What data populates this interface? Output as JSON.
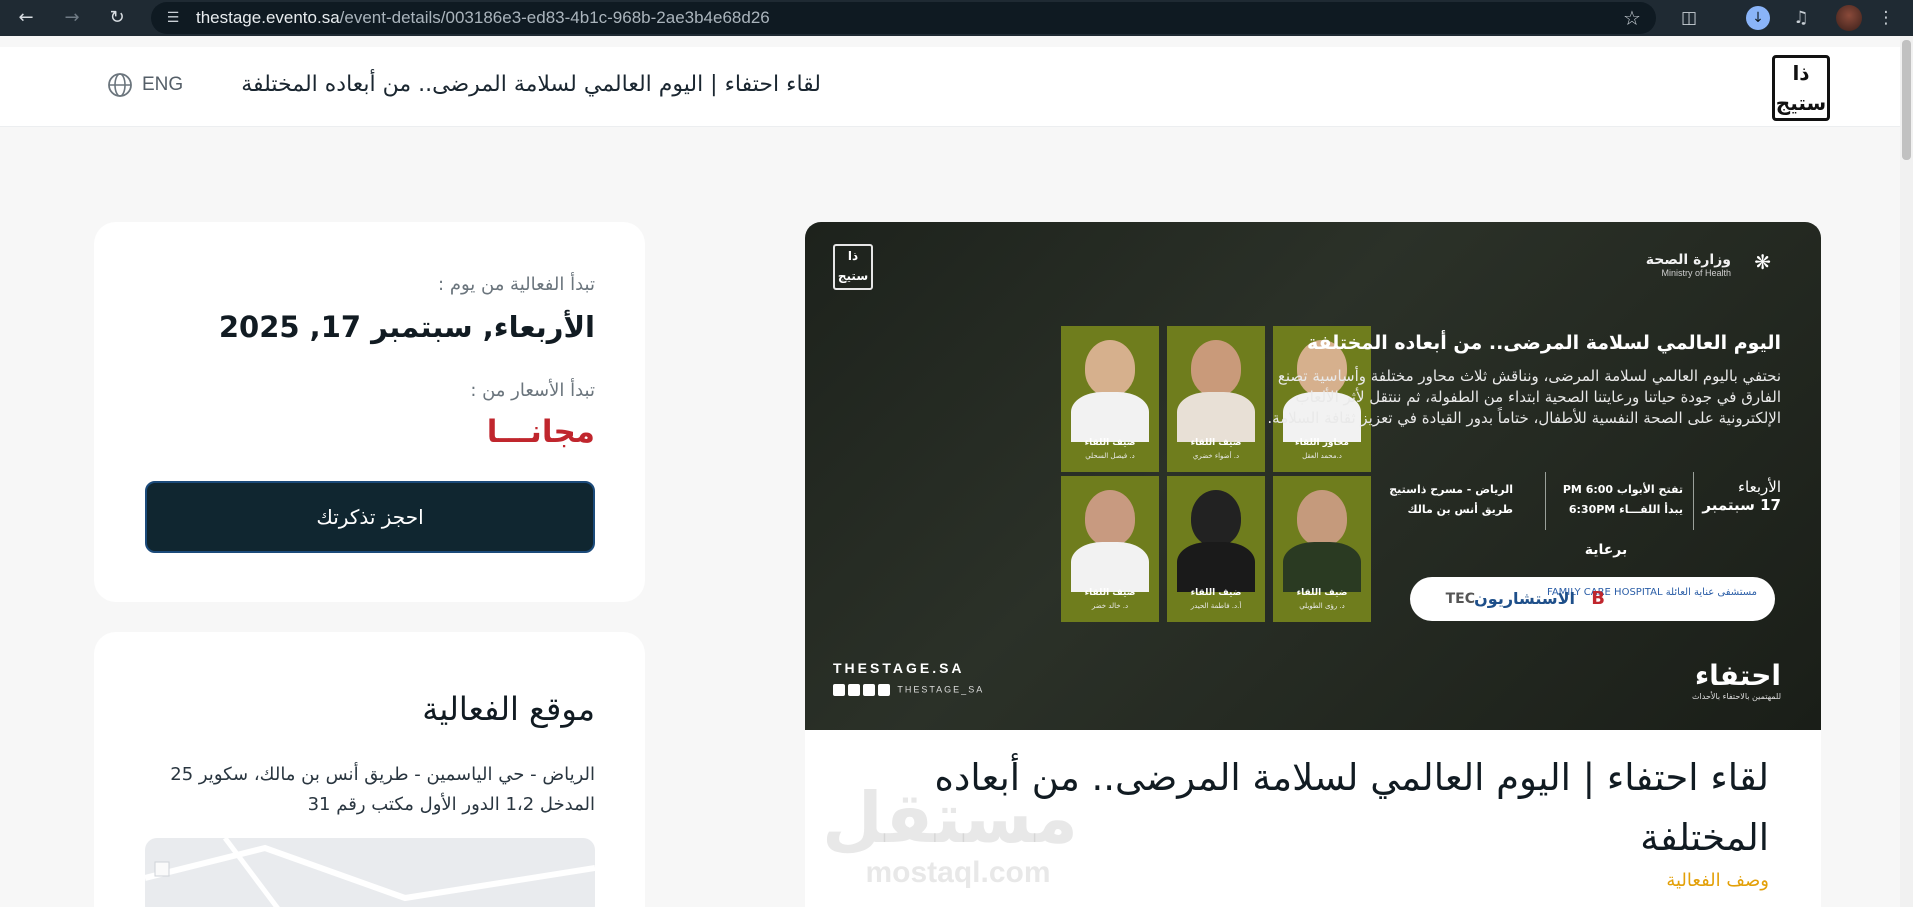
{
  "browser": {
    "url_host": "thestage.evento.sa",
    "url_path": "/event-details/003186e3-ed83-4b1c-968b-2ae3b4e68d26"
  },
  "header": {
    "lang_label": "ENG",
    "title": "لقاء احتفاء | اليوم العالمي لسلامة المرضى.. من أبعاده المختلفة",
    "logo_text": "ذا ستيج"
  },
  "info": {
    "start_label": "تبدأ الفعالية من يوم :",
    "start_date": "الأربعاء, سبتمبر 17, 2025",
    "price_label": "تبدأ الأسعار من :",
    "price": "مجانـــا",
    "book_button": "احجز تذكرتك",
    "price_color": "#c0262d"
  },
  "location": {
    "title": "موقع الفعالية",
    "address": "الرياض - حي الياسمين - طريق أنس بن مالك، سكوير 25 المدخل 1،2 الدور الأول مكتب رقم 31"
  },
  "banner": {
    "moh_ar": "وزارة الصحة",
    "moh_en": "Ministry of Health",
    "title": "اليوم العالمي لسلامة المرضى.. من أبعاده المختلفة",
    "description": "نحتفي باليوم العالمي لسلامة المرضى، ونناقش ثلاث محاور مختلفة وأساسية تصنع الفارق في جودة حياتنا ورعايتنا الصحية ابتداء من الطفولة، ثم ننتقل لأثر الألعاب الإلكترونية على الصحة النفسية للأطفال، ختاماً بدور القيادة في تعزيز ثقافة السلامة.",
    "day": "الأربعاء",
    "date": "17 سبتمبر",
    "doors": "تفتح الأبواب 6:00 PM",
    "start": "يبدأ اللقـــاء 6:30PM",
    "venue_1": "الرياض - مسرح ذاستيج",
    "venue_2": "طريق أنس بن مالك",
    "sponsor_label": "برعاية",
    "sponsors": [
      "مستشفى عناية العائلة FAMILY CARE HOSPITAL",
      "B",
      "الاستشاريون",
      "TEC"
    ],
    "site": "THESTAGE.SA",
    "social_handle": "THESTAGE_SA",
    "ehtifa": "احتفاء",
    "ehtifa_sub": "للمهتمين بالاحتفاء بالأحداث",
    "logo_left": "ذا ستيج",
    "speakers": [
      {
        "role": "محاور اللقاء",
        "name": "د.محمد العقل"
      },
      {
        "role": "ضيف اللقاء",
        "name": "د. أضواء خضري"
      },
      {
        "role": "ضيف اللقاء",
        "name": "د. فيصل السحلي"
      },
      {
        "role": "ضيف اللقاء",
        "name": "د. رؤى الطويلي"
      },
      {
        "role": "ضيف اللقاء",
        "name": "أ.د. فاطمة الحيدر"
      },
      {
        "role": "ضيف اللقاء",
        "name": "د. خالد خضر"
      }
    ]
  },
  "event": {
    "title": "لقاء احتفاء | اليوم العالمي لسلامة المرضى.. من أبعاده المختلفة",
    "desc_link": "وصف الفعالية"
  },
  "watermark": {
    "ar": "مستقل",
    "en": "mostaql.com"
  }
}
